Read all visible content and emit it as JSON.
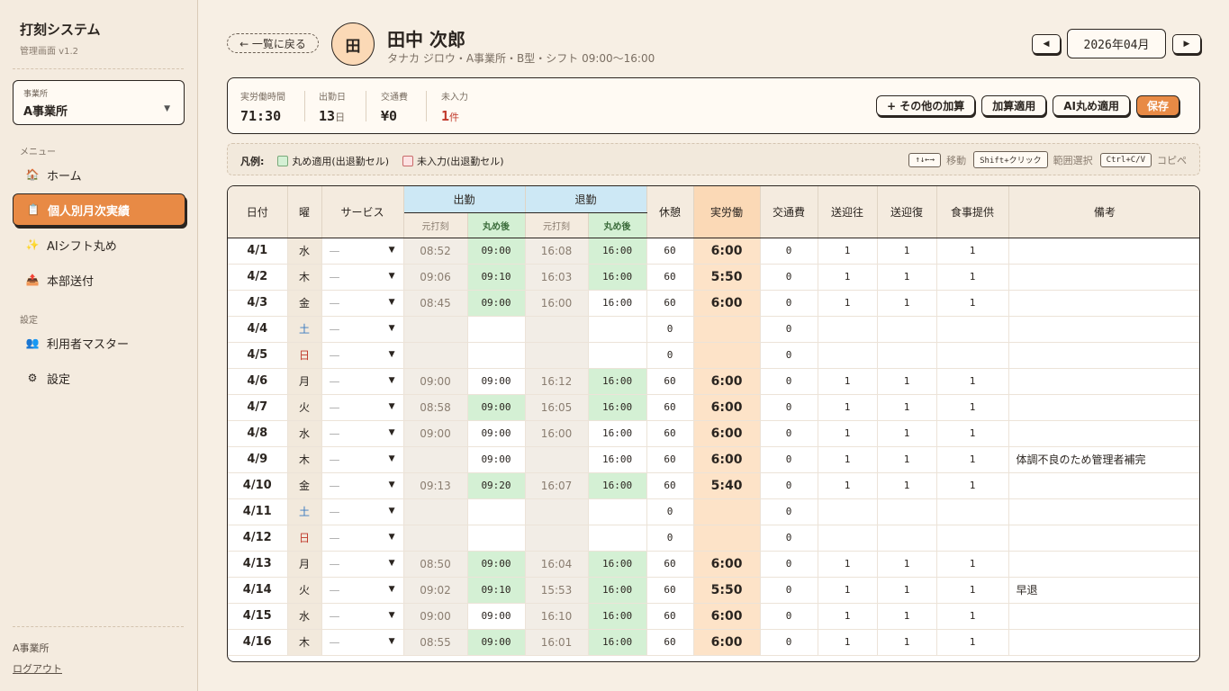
{
  "sidebar": {
    "title": "打刻システム",
    "version": "管理画面 v1.2",
    "office_label": "事業所",
    "office_value": "A事業所",
    "menu_heading": "メニュー",
    "items": [
      {
        "label": "ホーム",
        "icon": "🏠"
      },
      {
        "label": "個人別月次実績",
        "icon": "📋"
      },
      {
        "label": "AIシフト丸め",
        "icon": "✨"
      },
      {
        "label": "本部送付",
        "icon": "📤"
      }
    ],
    "settings_heading": "設定",
    "settings_items": [
      {
        "label": "利用者マスター",
        "icon": "👥"
      },
      {
        "label": "設定",
        "icon": "⚙"
      }
    ],
    "footer_office": "A事業所",
    "logout": "ログアウト"
  },
  "header": {
    "back": "← 一覧に戻る",
    "avatar": "田",
    "name": "田中 次郎",
    "sub": "タナカ ジロウ・A事業所・B型・シフト 09:00〜16:00",
    "month": "2026年04月",
    "prev": "◀",
    "next": "▶"
  },
  "summary": {
    "work_label": "実労働時間",
    "work_value": "71:30",
    "days_label": "出勤日",
    "days_value": "13",
    "days_unit": "日",
    "fare_label": "交通費",
    "fare_value": "¥0",
    "missing_label": "未入力",
    "missing_value": "1",
    "missing_unit": "件",
    "buttons": {
      "other": "+ その他の加算",
      "apply_add": "加算適用",
      "ai": "AI丸め適用",
      "save": "保存"
    }
  },
  "legend": {
    "title": "凡例:",
    "green": "丸め適用(出退勤セル)",
    "red": "未入力(出退勤セル)",
    "k1": "↑↓←→",
    "t1": "移動",
    "k2": "Shift+クリック",
    "t2": "範囲選択",
    "k3": "Ctrl+C/V",
    "t3": "コピペ"
  },
  "colors": {
    "accent": "#e88a45",
    "rounded": "#d4f0d4",
    "work": "#fde3c8",
    "header_blue": "#cde8f5"
  },
  "table": {
    "headers": {
      "date": "日付",
      "dow": "曜",
      "service": "サービス",
      "in": "出勤",
      "out": "退勤",
      "orig": "元打刻",
      "rounded": "丸め後",
      "break": "休憩",
      "work": "実労働",
      "fare": "交通費",
      "pickup": "送迎往",
      "dropoff": "送迎復",
      "meal": "食事提供",
      "note": "備考"
    },
    "service_placeholder": "—",
    "rows": [
      {
        "date": "4/1",
        "dow": "水",
        "in_o": "08:52",
        "in_r": "09:00",
        "in_g": true,
        "out_o": "16:08",
        "out_r": "16:00",
        "out_g": true,
        "brk": "60",
        "work": "6:00",
        "fare": "0",
        "pu": "1",
        "dr": "1",
        "meal": "1",
        "note": ""
      },
      {
        "date": "4/2",
        "dow": "木",
        "in_o": "09:06",
        "in_r": "09:10",
        "in_g": true,
        "out_o": "16:03",
        "out_r": "16:00",
        "out_g": true,
        "brk": "60",
        "work": "5:50",
        "fare": "0",
        "pu": "1",
        "dr": "1",
        "meal": "1",
        "note": ""
      },
      {
        "date": "4/3",
        "dow": "金",
        "in_o": "08:45",
        "in_r": "09:00",
        "in_g": true,
        "out_o": "16:00",
        "out_r": "16:00",
        "out_g": false,
        "brk": "60",
        "work": "6:00",
        "fare": "0",
        "pu": "1",
        "dr": "1",
        "meal": "1",
        "note": ""
      },
      {
        "date": "4/4",
        "dow": "土",
        "in_o": "",
        "in_r": "",
        "in_g": false,
        "out_o": "",
        "out_r": "",
        "out_g": false,
        "brk": "0",
        "work": "",
        "fare": "0",
        "pu": "",
        "dr": "",
        "meal": "",
        "note": ""
      },
      {
        "date": "4/5",
        "dow": "日",
        "in_o": "",
        "in_r": "",
        "in_g": false,
        "out_o": "",
        "out_r": "",
        "out_g": false,
        "brk": "0",
        "work": "",
        "fare": "0",
        "pu": "",
        "dr": "",
        "meal": "",
        "note": ""
      },
      {
        "date": "4/6",
        "dow": "月",
        "in_o": "09:00",
        "in_r": "09:00",
        "in_g": false,
        "out_o": "16:12",
        "out_r": "16:00",
        "out_g": true,
        "brk": "60",
        "work": "6:00",
        "fare": "0",
        "pu": "1",
        "dr": "1",
        "meal": "1",
        "note": ""
      },
      {
        "date": "4/7",
        "dow": "火",
        "in_o": "08:58",
        "in_r": "09:00",
        "in_g": true,
        "out_o": "16:05",
        "out_r": "16:00",
        "out_g": true,
        "brk": "60",
        "work": "6:00",
        "fare": "0",
        "pu": "1",
        "dr": "1",
        "meal": "1",
        "note": ""
      },
      {
        "date": "4/8",
        "dow": "水",
        "in_o": "09:00",
        "in_r": "09:00",
        "in_g": false,
        "out_o": "16:00",
        "out_r": "16:00",
        "out_g": false,
        "brk": "60",
        "work": "6:00",
        "fare": "0",
        "pu": "1",
        "dr": "1",
        "meal": "1",
        "note": ""
      },
      {
        "date": "4/9",
        "dow": "木",
        "in_o": "",
        "in_r": "09:00",
        "in_g": false,
        "out_o": "",
        "out_r": "16:00",
        "out_g": false,
        "brk": "60",
        "work": "6:00",
        "fare": "0",
        "pu": "1",
        "dr": "1",
        "meal": "1",
        "note": "体調不良のため管理者補完"
      },
      {
        "date": "4/10",
        "dow": "金",
        "in_o": "09:13",
        "in_r": "09:20",
        "in_g": true,
        "out_o": "16:07",
        "out_r": "16:00",
        "out_g": true,
        "brk": "60",
        "work": "5:40",
        "fare": "0",
        "pu": "1",
        "dr": "1",
        "meal": "1",
        "note": ""
      },
      {
        "date": "4/11",
        "dow": "土",
        "in_o": "",
        "in_r": "",
        "in_g": false,
        "out_o": "",
        "out_r": "",
        "out_g": false,
        "brk": "0",
        "work": "",
        "fare": "0",
        "pu": "",
        "dr": "",
        "meal": "",
        "note": ""
      },
      {
        "date": "4/12",
        "dow": "日",
        "in_o": "",
        "in_r": "",
        "in_g": false,
        "out_o": "",
        "out_r": "",
        "out_g": false,
        "brk": "0",
        "work": "",
        "fare": "0",
        "pu": "",
        "dr": "",
        "meal": "",
        "note": ""
      },
      {
        "date": "4/13",
        "dow": "月",
        "in_o": "08:50",
        "in_r": "09:00",
        "in_g": true,
        "out_o": "16:04",
        "out_r": "16:00",
        "out_g": true,
        "brk": "60",
        "work": "6:00",
        "fare": "0",
        "pu": "1",
        "dr": "1",
        "meal": "1",
        "note": ""
      },
      {
        "date": "4/14",
        "dow": "火",
        "in_o": "09:02",
        "in_r": "09:10",
        "in_g": true,
        "out_o": "15:53",
        "out_r": "16:00",
        "out_g": true,
        "brk": "60",
        "work": "5:50",
        "fare": "0",
        "pu": "1",
        "dr": "1",
        "meal": "1",
        "note": "早退"
      },
      {
        "date": "4/15",
        "dow": "水",
        "in_o": "09:00",
        "in_r": "09:00",
        "in_g": false,
        "out_o": "16:10",
        "out_r": "16:00",
        "out_g": true,
        "brk": "60",
        "work": "6:00",
        "fare": "0",
        "pu": "1",
        "dr": "1",
        "meal": "1",
        "note": ""
      },
      {
        "date": "4/16",
        "dow": "木",
        "in_o": "08:55",
        "in_r": "09:00",
        "in_g": true,
        "out_o": "16:01",
        "out_r": "16:00",
        "out_g": true,
        "brk": "60",
        "work": "6:00",
        "fare": "0",
        "pu": "1",
        "dr": "1",
        "meal": "1",
        "note": ""
      }
    ]
  }
}
